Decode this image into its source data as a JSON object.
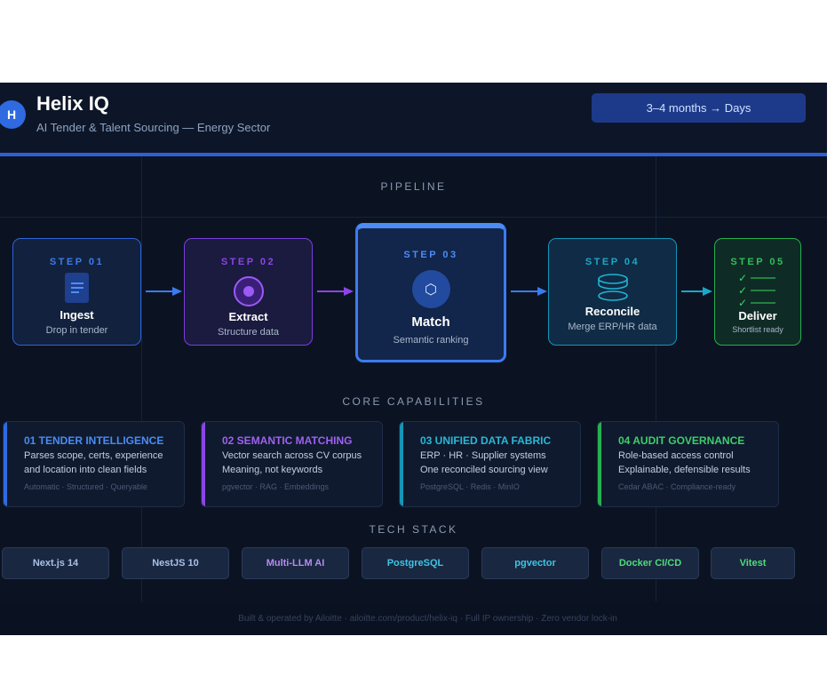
{
  "header": {
    "logo_letter": "H",
    "title": "Helix IQ",
    "subtitle": "AI Tender & Talent Sourcing — Energy Sector",
    "badge": "3–4 months → Days"
  },
  "sections": {
    "pipeline": "PIPELINE",
    "capabilities": "CORE CAPABILITIES",
    "tech_stack": "TECH STACK"
  },
  "pipeline": [
    {
      "num": "STEP 01",
      "name": "Ingest",
      "desc": "Drop in tender",
      "color": "#3b7bf0",
      "icon": "document-icon"
    },
    {
      "num": "STEP 02",
      "name": "Extract",
      "desc": "Structure data",
      "color": "#8b45e6",
      "icon": "target-icon"
    },
    {
      "num": "STEP 03",
      "name": "Match",
      "desc": "Semantic ranking",
      "color": "#4b8cf5",
      "icon": "hexagon-icon"
    },
    {
      "num": "STEP 04",
      "name": "Reconcile",
      "desc": "Merge ERP/HR data",
      "color": "#1aa8c8",
      "icon": "database-icon"
    },
    {
      "num": "STEP 05",
      "name": "Deliver",
      "desc": "Shortlist ready",
      "color": "#2fbf58",
      "icon": "checklist-icon"
    }
  ],
  "capabilities": [
    {
      "title": "01 TENDER INTELLIGENCE",
      "lines": [
        "Parses scope, certs, experience",
        "and location into clean fields"
      ],
      "tags": "Automatic · Structured · Queryable",
      "color": "#4a8cf5"
    },
    {
      "title": "02 SEMANTIC MATCHING",
      "lines": [
        "Vector search across CV corpus",
        "Meaning, not keywords"
      ],
      "tags": "pgvector · RAG · Embeddings",
      "color": "#a061f0"
    },
    {
      "title": "03 UNIFIED DATA FABRIC",
      "lines": [
        "ERP · HR · Supplier systems",
        "One reconciled sourcing view"
      ],
      "tags": "PostgreSQL · Redis · MinIO",
      "color": "#2ab8d6"
    },
    {
      "title": "04 AUDIT GOVERNANCE",
      "lines": [
        "Role-based access control",
        "Explainable, defensible results"
      ],
      "tags": "Cedar ABAC · Compliance-ready",
      "color": "#3ccf6a"
    }
  ],
  "tech": [
    {
      "label": "Next.js 14",
      "color": "#a9c1e8"
    },
    {
      "label": "NestJS 10",
      "color": "#a9c1e8"
    },
    {
      "label": "Multi-LLM AI",
      "color": "#b38cf2"
    },
    {
      "label": "PostgreSQL",
      "color": "#3fc4e4"
    },
    {
      "label": "pgvector",
      "color": "#3fc4e4"
    },
    {
      "label": "Docker CI/CD",
      "color": "#4ddc7c"
    },
    {
      "label": "Vitest",
      "color": "#4ddc7c"
    }
  ],
  "footer": "Built & operated by Ailoitte · ailoitte.com/product/helix-iq · Full IP ownership · Zero vendor lock-in"
}
